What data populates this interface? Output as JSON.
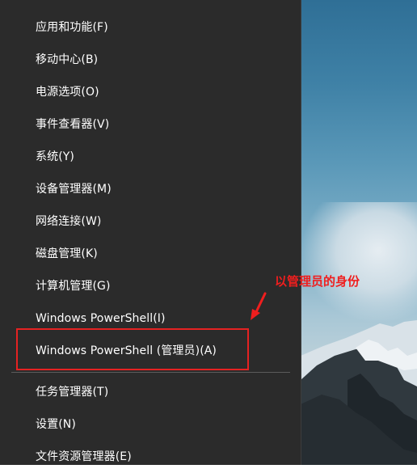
{
  "menu": {
    "items": [
      {
        "label": "应用和功能(F)"
      },
      {
        "label": "移动中心(B)"
      },
      {
        "label": "电源选项(O)"
      },
      {
        "label": "事件查看器(V)"
      },
      {
        "label": "系统(Y)"
      },
      {
        "label": "设备管理器(M)"
      },
      {
        "label": "网络连接(W)"
      },
      {
        "label": "磁盘管理(K)"
      },
      {
        "label": "计算机管理(G)"
      },
      {
        "label": "Windows PowerShell(I)"
      },
      {
        "label": "Windows PowerShell (管理员)(A)"
      },
      {
        "label": "任务管理器(T)"
      },
      {
        "label": "设置(N)"
      },
      {
        "label": "文件资源管理器(E)"
      }
    ]
  },
  "annotation": {
    "text": "以管理员的身份",
    "color": "#f01e1e"
  },
  "colors": {
    "menu_background": "#2b2b2b",
    "menu_text": "#ffffff",
    "highlight_border": "#e52222"
  }
}
